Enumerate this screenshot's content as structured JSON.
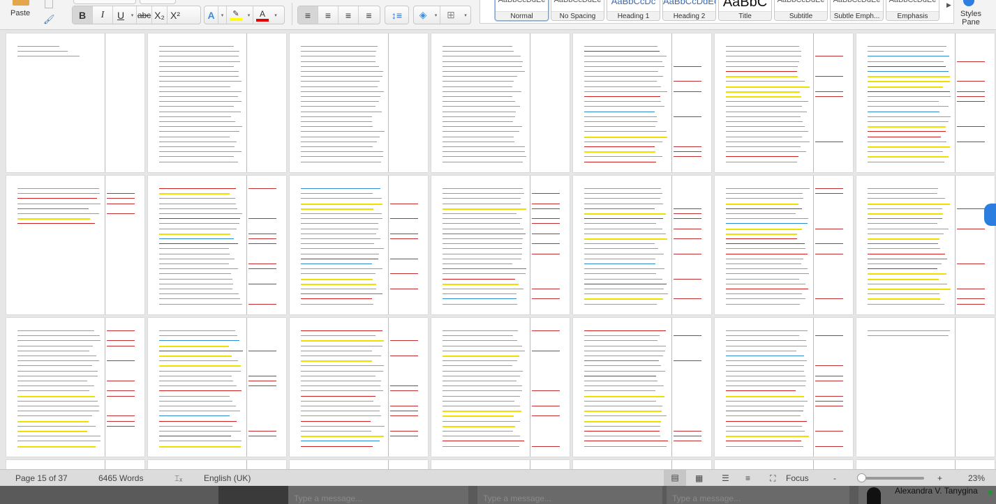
{
  "ribbon": {
    "paste_label": "Paste",
    "font_buttons": [
      "B",
      "I",
      "U",
      "abc",
      "X₂",
      "X²"
    ],
    "styles": [
      {
        "preview": "AaBbCcDdEe",
        "label": "Normal",
        "selected": true
      },
      {
        "preview": "AaBbCcDdEe",
        "label": "No Spacing"
      },
      {
        "preview": "AaBbCcDc",
        "label": "Heading 1"
      },
      {
        "preview": "AaBbCcDdEe",
        "label": "Heading 2"
      },
      {
        "preview": "AaBbC",
        "label": "Title"
      },
      {
        "preview": "AaBbCcDdEe",
        "label": "Subtitle"
      },
      {
        "preview": "AaBbCcDdEe",
        "label": "Subtle Emph..."
      },
      {
        "preview": "AaBbCcDdEe",
        "label": "Emphasis"
      }
    ],
    "styles_pane": "Styles Pane",
    "highlight_color": "#ffff00",
    "font_color": "#e00000"
  },
  "status": {
    "page": "Page 15 of 37",
    "words": "6465 Words",
    "language": "English (UK)",
    "focus": "Focus",
    "zoom": "23%",
    "zoom_minus": "-",
    "zoom_plus": "+"
  },
  "taskbar": {
    "placeholders": [
      "Type a message...",
      "Type a message...",
      "Type a message..."
    ],
    "user": "Alexandra V. Tanygina"
  }
}
